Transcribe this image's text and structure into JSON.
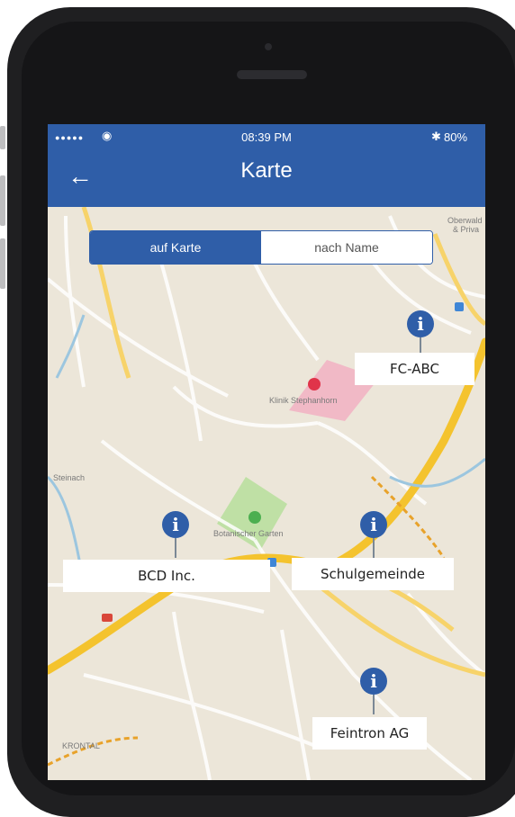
{
  "status_bar": {
    "signal": "●●●●●",
    "wifi_icon": "wifi-icon",
    "time": "08:39 PM",
    "bluetooth": "✱",
    "battery": "80%"
  },
  "nav": {
    "title": "Karte",
    "back_icon": "arrow-left-icon"
  },
  "segmented": {
    "options": [
      "auf Karte",
      "nach Name"
    ],
    "selected": "auf Karte"
  },
  "map": {
    "labels": {
      "klinik": "Klinik Stephanhorn",
      "garten": "Botanischer Garten",
      "oberwald": "Oberwald",
      "priva": "& Priva",
      "krontal": "KRONTAL",
      "stbach": "Steinach"
    },
    "pins": [
      {
        "name": "FC-ABC",
        "icon": "info-pin-icon"
      },
      {
        "name": "BCD Inc.",
        "icon": "info-pin-icon"
      },
      {
        "name": "Schulgemeinde",
        "icon": "info-pin-icon"
      },
      {
        "name": "Feintron AG",
        "icon": "info-pin-icon"
      }
    ]
  }
}
